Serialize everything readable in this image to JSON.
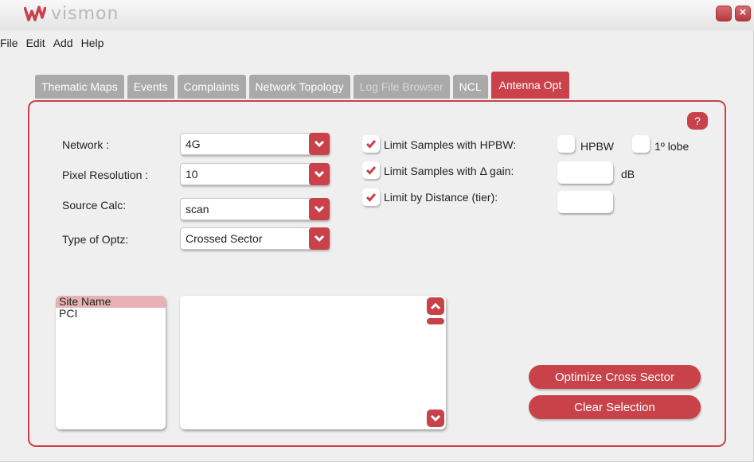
{
  "app": {
    "logo_text": "vismon"
  },
  "menu": [
    "File",
    "Edit",
    "Add",
    "Help"
  ],
  "tabs": [
    {
      "label": "Thematic Maps",
      "state": "normal"
    },
    {
      "label": "Events",
      "state": "normal"
    },
    {
      "label": "Complaints",
      "state": "normal"
    },
    {
      "label": "Network Topology",
      "state": "normal"
    },
    {
      "label": "Log File Browser",
      "state": "disabled"
    },
    {
      "label": "NCL",
      "state": "normal"
    },
    {
      "label": "Antenna Opt",
      "state": "active"
    }
  ],
  "help_label": "?",
  "form": {
    "network_label": "Network :",
    "network_value": "4G",
    "pixel_label": "Pixel Resolution :",
    "pixel_value": "10",
    "source_label": "Source Calc:",
    "source_value": "scan",
    "optz_label": "Type of Optz:",
    "optz_value": "Crossed Sector"
  },
  "limits": {
    "hpbw_label": "Limit Samples with HPBW:",
    "hpbw_checked": true,
    "hpbw_option": "HPBW",
    "lobe_option": "1º lobe",
    "gain_label": "Limit Samples with Δ gain:",
    "gain_checked": true,
    "gain_unit": "dB",
    "distance_label": "Limit by Distance (tier):",
    "distance_checked": true
  },
  "field_list": [
    "Site Name",
    "PCI"
  ],
  "buttons": {
    "optimize": "Optimize Cross Sector",
    "clear": "Clear Selection"
  },
  "colors": {
    "accent": "#c9424a",
    "tab_inactive": "#a9a9a9",
    "selection": "#e8b1b4"
  }
}
